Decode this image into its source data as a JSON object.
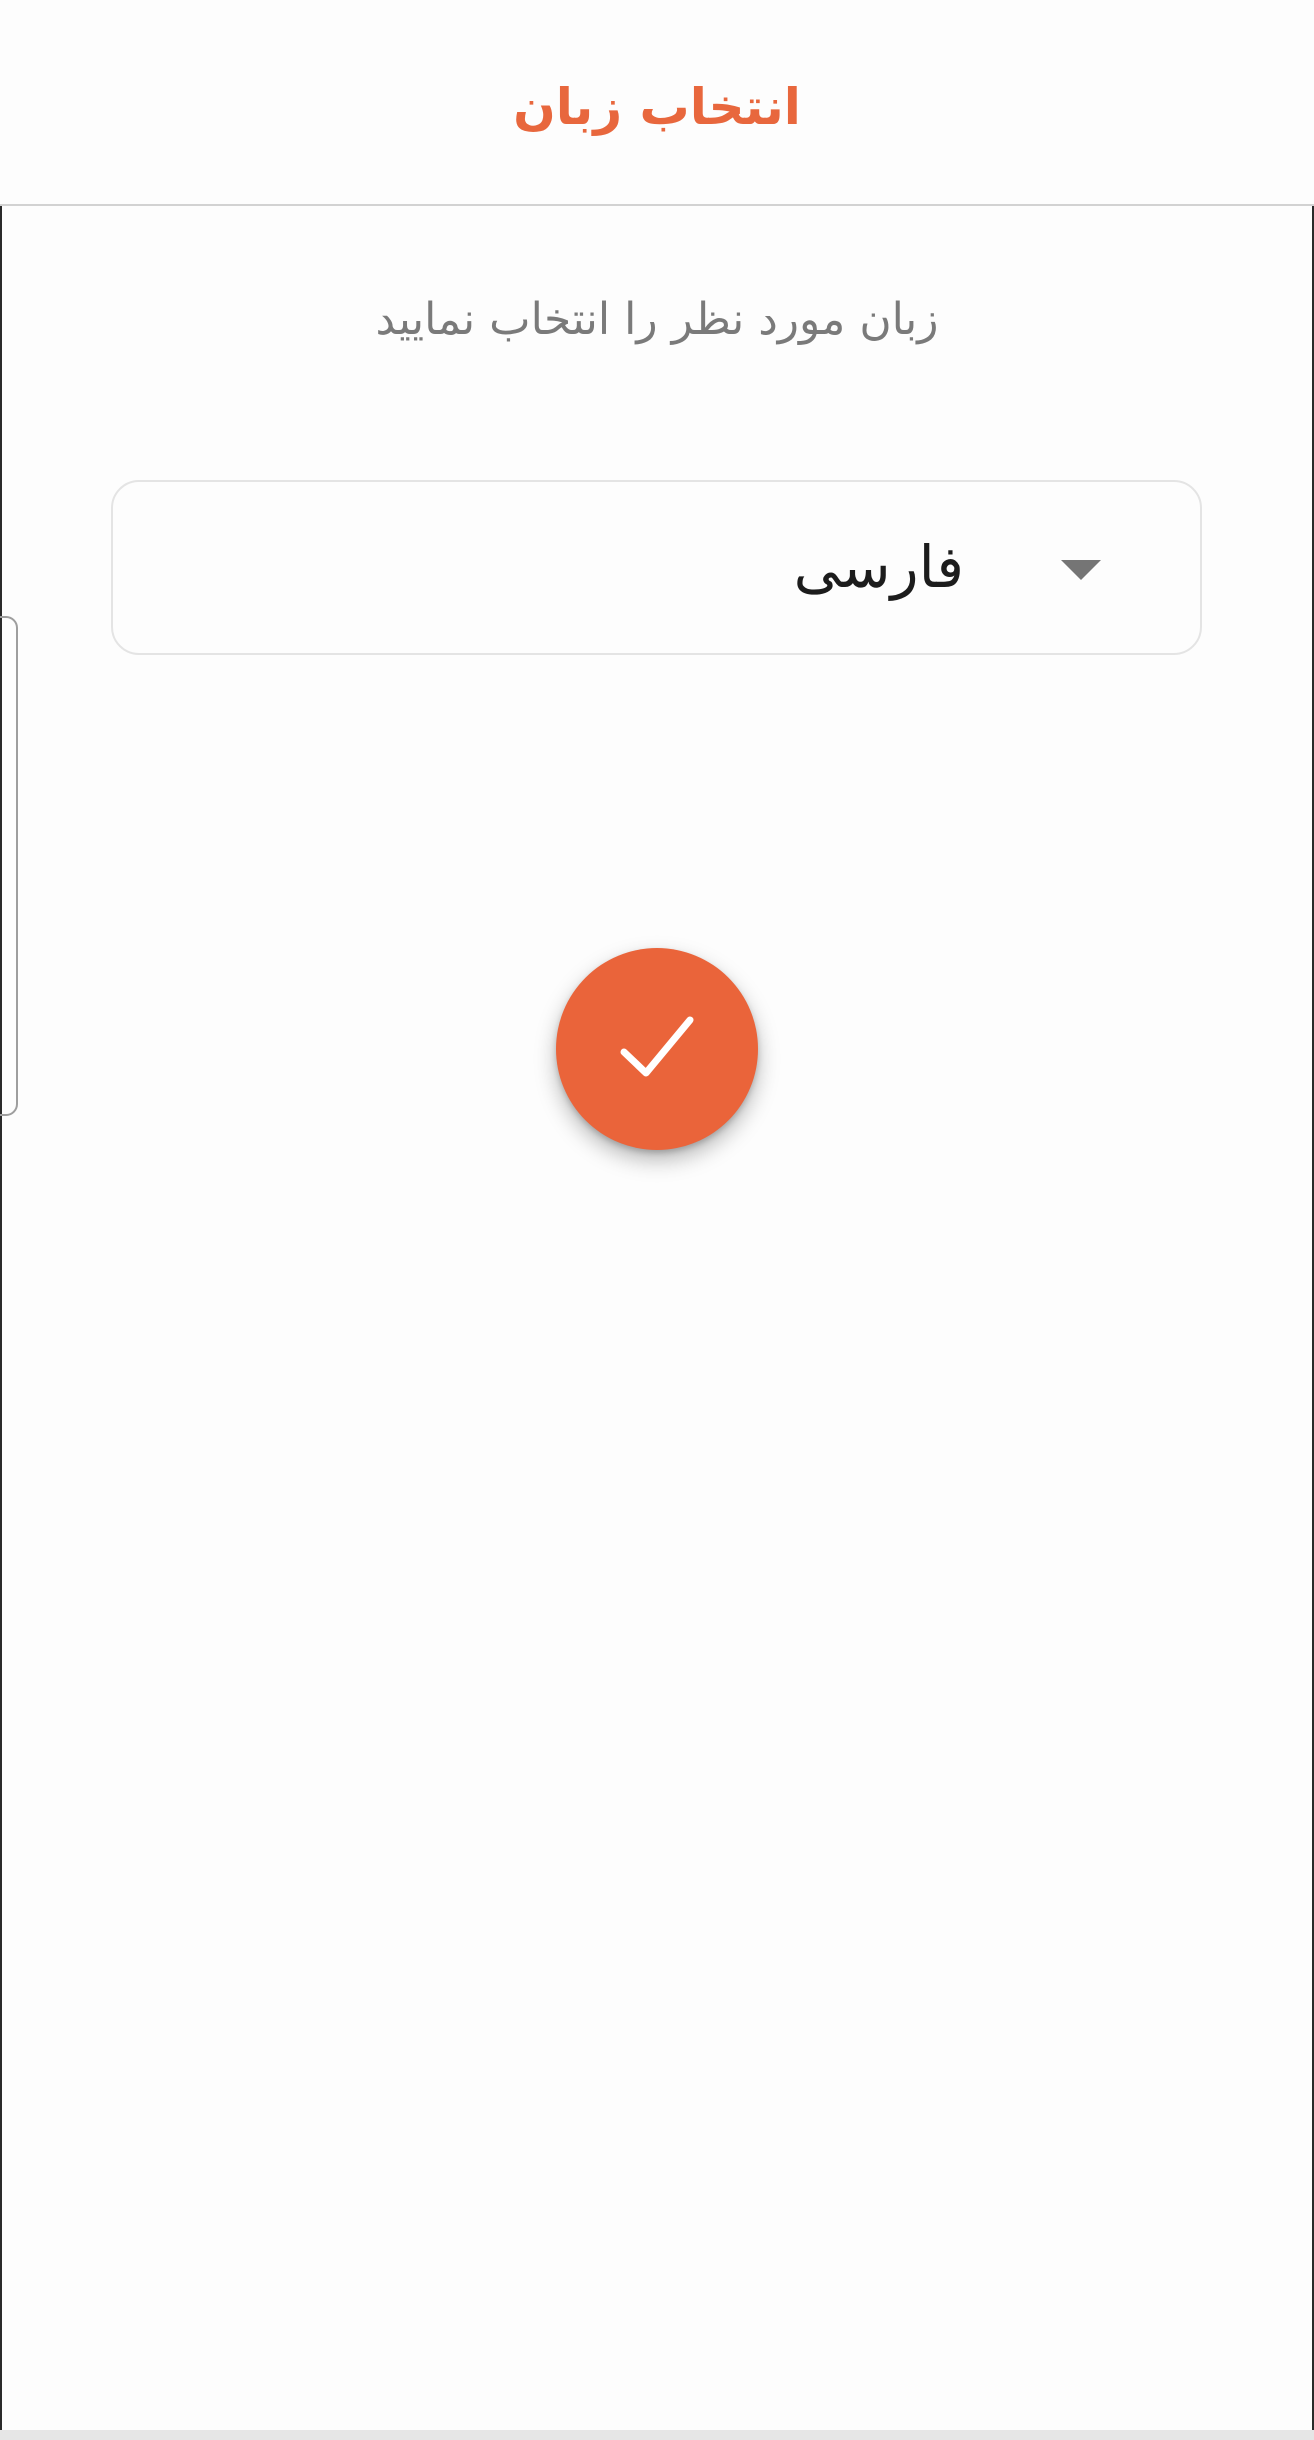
{
  "header": {
    "title": "انتخاب زبان"
  },
  "instruction": "زبان مورد نظر را انتخاب نمایید",
  "language_select": {
    "selected_value": "فارسی",
    "caret_icon": "dropdown-caret-icon"
  },
  "confirm_button": {
    "icon": "checkmark-icon",
    "background_color": "#ea643a"
  },
  "colors": {
    "accent": "#e8673d",
    "instruction_text": "#7a7a7a",
    "divider": "#d2d2d2"
  }
}
